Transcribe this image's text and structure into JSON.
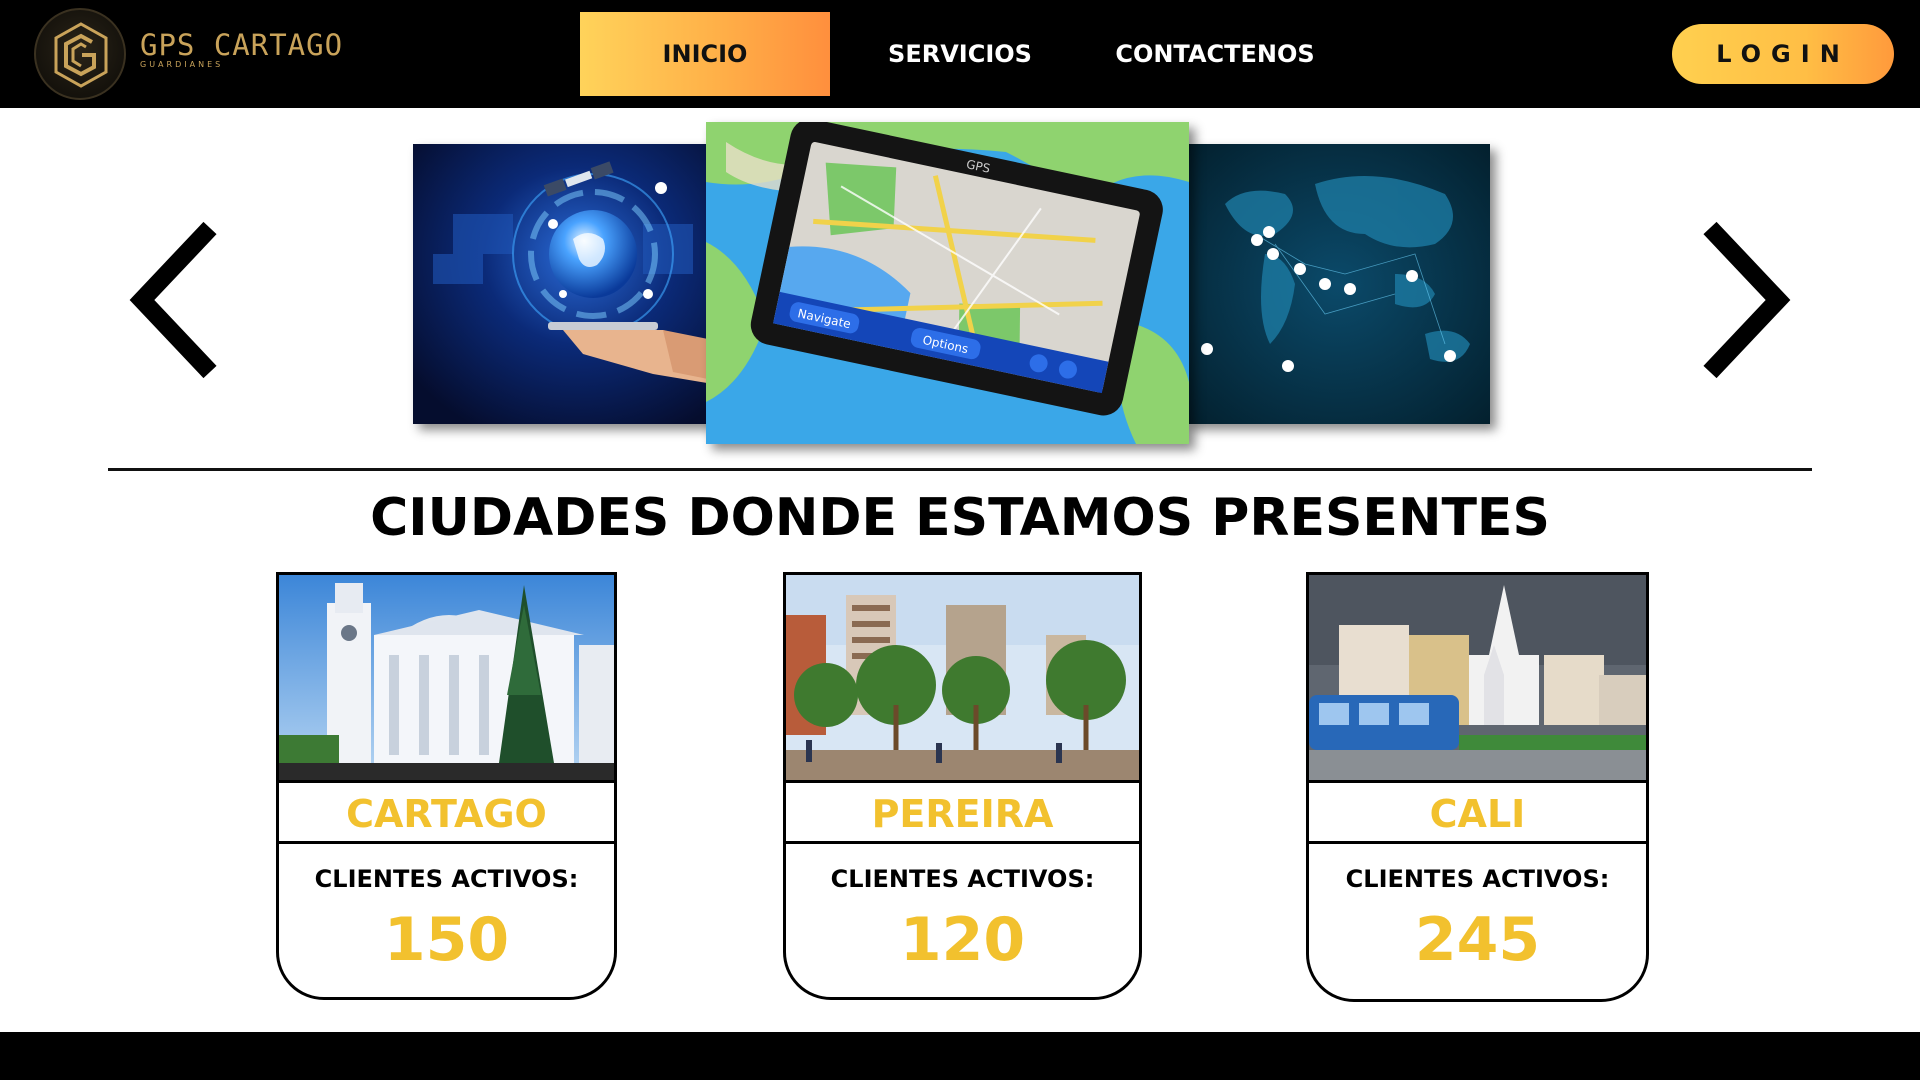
{
  "header": {
    "brand_name": "GPS CARTAGO",
    "brand_sub": "GUARDIANES",
    "nav": [
      {
        "label": "INICIO",
        "active": true
      },
      {
        "label": "SERVICIOS",
        "active": false
      },
      {
        "label": "CONTACTENOS",
        "active": false
      }
    ],
    "login_label": "LOGIN"
  },
  "colors": {
    "accent_gradient_start": "#ffd35a",
    "accent_gradient_end": "#ff8f3d",
    "city_yellow": "#f2c12e",
    "header_bg": "#000000"
  },
  "carousel": {
    "slides": [
      {
        "icon": "globe-satellite-hand-image"
      },
      {
        "icon": "gps-tablet-map-image",
        "buttons": [
          "Navigate",
          "Options"
        ],
        "device_label": "GPS"
      },
      {
        "icon": "world-map-pins-image"
      }
    ]
  },
  "section": {
    "title": "CIUDADES DONDE ESTAMOS PRESENTES"
  },
  "cities": [
    {
      "name": "CARTAGO",
      "label": "CLIENTES ACTIVOS:",
      "count": "150"
    },
    {
      "name": "PEREIRA",
      "label": "CLIENTES ACTIVOS:",
      "count": "120"
    },
    {
      "name": "CALI",
      "label": "CLIENTES ACTIVOS:",
      "count": "245"
    }
  ]
}
